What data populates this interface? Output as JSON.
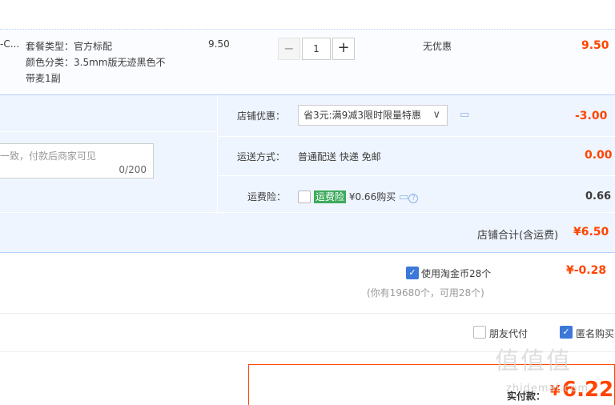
{
  "item": {
    "title_fragment": "-C...",
    "spec_line1": "套餐类型：官方标配",
    "spec_line2": "颜色分类：3.5mm版无迹黑色不",
    "spec_line3": "带麦1副",
    "unit_price": "9.50",
    "quantity": "1",
    "minus": "−",
    "plus": "+",
    "promo": "无优惠",
    "subtotal": "9.50"
  },
  "memo": {
    "placeholder": "一致，付款后商家可见",
    "counter": "0/200"
  },
  "shop": {
    "discount_label": "店铺优惠：",
    "discount_value": "省3元:满9减3限时限量特惠",
    "discount_amount": "-3.00",
    "shipping_label": "运送方式：",
    "shipping_value": "普通配送 快递 免邮",
    "shipping_amount": "0.00",
    "insurance_label": "运费险：",
    "insurance_tag": "运费险",
    "insurance_text": "¥0.66购买",
    "insurance_amount": "0.66",
    "total_label": "店铺合计(含运费)",
    "total_value": "¥6.50"
  },
  "coins": {
    "label": "使用淘金币28个",
    "amount": "¥-0.28",
    "note": "(你有19680个，可用28个)"
  },
  "options": {
    "friend_pay": "朋友代付",
    "anonymous": "匿名购买"
  },
  "pay": {
    "label": "实付款：",
    "currency": "¥",
    "value": "6.22"
  },
  "watermark": {
    "logo": "值值值",
    "site": "zhidemai.com"
  },
  "colors": {
    "accent_red": "#ff4400",
    "panel_blue": "#eff5ff",
    "checkbox_blue": "#3c78d8",
    "tag_green": "#3daa5c"
  }
}
